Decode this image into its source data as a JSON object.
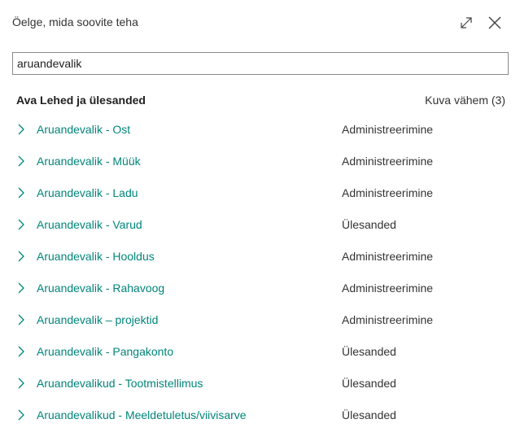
{
  "header": {
    "title": "Öelge, mida soovite teha",
    "expand_icon": "expand-icon",
    "close_icon": "close-icon"
  },
  "search": {
    "value": "aruandevalik"
  },
  "section": {
    "title": "Ava Lehed ja ülesanded",
    "toggle_label": "Kuva vähem (3)"
  },
  "results": [
    {
      "name": "Aruandevalik - Ost",
      "category": "Administreerimine"
    },
    {
      "name": "Aruandevalik - Müük",
      "category": "Administreerimine"
    },
    {
      "name": "Aruandevalik - Ladu",
      "category": "Administreerimine"
    },
    {
      "name": "Aruandevalik - Varud",
      "category": "Ülesanded"
    },
    {
      "name": "Aruandevalik - Hooldus",
      "category": "Administreerimine"
    },
    {
      "name": "Aruandevalik - Rahavoog",
      "category": "Administreerimine"
    },
    {
      "name": "Aruandevalik – projektid",
      "category": "Administreerimine"
    },
    {
      "name": "Aruandevalik - Pangakonto",
      "category": "Ülesanded"
    },
    {
      "name": "Aruandevalikud - Tootmistellimus",
      "category": "Ülesanded"
    },
    {
      "name": "Aruandevalikud - Meeldetuletus/viivisarve",
      "category": "Ülesanded"
    }
  ],
  "colors": {
    "link": "#00857a",
    "chevron": "#00857a",
    "border": "#8a8a8a"
  }
}
